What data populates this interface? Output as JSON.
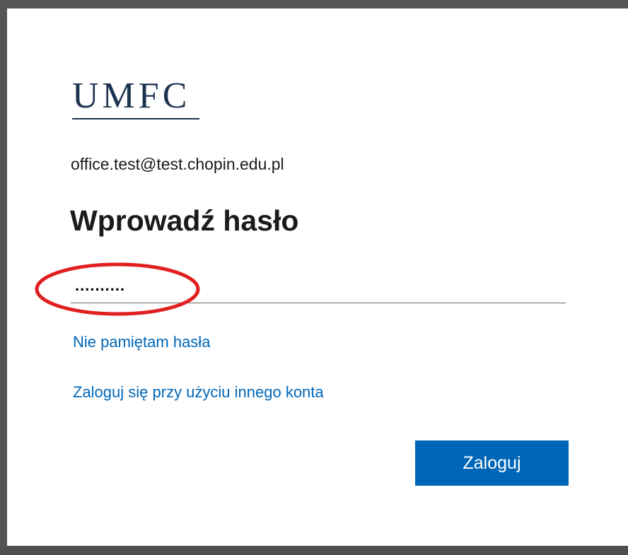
{
  "brand": {
    "logo_text": "UMFC",
    "logo_color": "#1c3350"
  },
  "login": {
    "email": "office.test@test.chopin.edu.pl",
    "heading": "Wprowadź hasło",
    "password_value": "..........",
    "forgot_password_link": "Nie pamiętam hasła",
    "other_account_link": "Zaloguj się przy użyciu innego konta",
    "submit_label": "Zaloguj"
  },
  "colors": {
    "accent": "#0067b8",
    "highlight": "#e02020",
    "text": "#1b1b1b"
  }
}
